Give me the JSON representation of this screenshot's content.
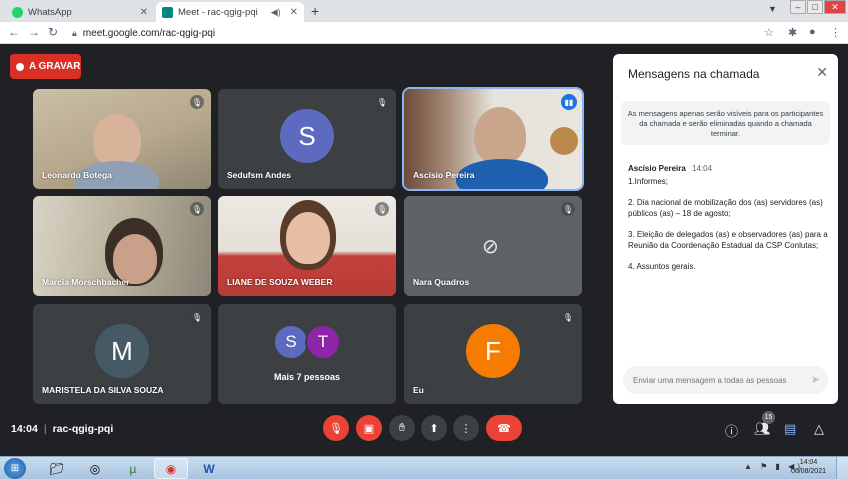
{
  "browser": {
    "tabs": [
      {
        "label": "WhatsApp",
        "active": false
      },
      {
        "label": "Meet - rac-qgig-pqi",
        "active": true
      }
    ],
    "url": "meet.google.com/rac-qgig-pqi"
  },
  "meet": {
    "recording_label": "A GRAVAR",
    "tiles": [
      {
        "name": "Leonardo Botega",
        "type": "video"
      },
      {
        "name": "Sedufsm Andes",
        "type": "avatar",
        "initial": "S",
        "color": "#5c6bc0"
      },
      {
        "name": "Ascísio Pereira",
        "type": "video",
        "speaking": true
      },
      {
        "name": "Marcia Morschbacher",
        "type": "video"
      },
      {
        "name": "LIANE DE SOUZA WEBER",
        "type": "video"
      },
      {
        "name": "Nara Quadros",
        "type": "camera-off"
      },
      {
        "name": "MARISTELA DA SILVA SOUZA",
        "type": "avatar",
        "initial": "M",
        "color": "#455a64"
      },
      {
        "name": "Mais 7 pessoas",
        "type": "more",
        "initials": [
          "S",
          "T"
        ],
        "colors": [
          "#5c6bc0",
          "#8e24aa"
        ]
      },
      {
        "name": "Eu",
        "type": "avatar",
        "initial": "F",
        "color": "#f57c00"
      }
    ],
    "time": "14:04",
    "meeting_code": "rac-qgig-pqi",
    "participants_count": "15"
  },
  "chat": {
    "title": "Mensagens na chamada",
    "note": "As mensagens apenas serão visíveis para os participantes da chamada e serão eliminadas quando a chamada terminar.",
    "messages": [
      {
        "author": "Ascísio Pereira",
        "time": "14:04",
        "lines": [
          "1.Informes;",
          "2. Dia nacional de mobilização dos (as) servidores (as) públicos (as) – 18 de agosto;",
          "3. Eleição de delegados (as) e observadores (as) para a Reunião da Coordenação Estadual da CSP Conlutas;",
          "4. Assuntos gerais."
        ]
      }
    ],
    "input_placeholder": "Enviar uma mensagem a todas as pessoas"
  },
  "taskbar": {
    "time": "14:04",
    "date": "06/08/2021"
  }
}
